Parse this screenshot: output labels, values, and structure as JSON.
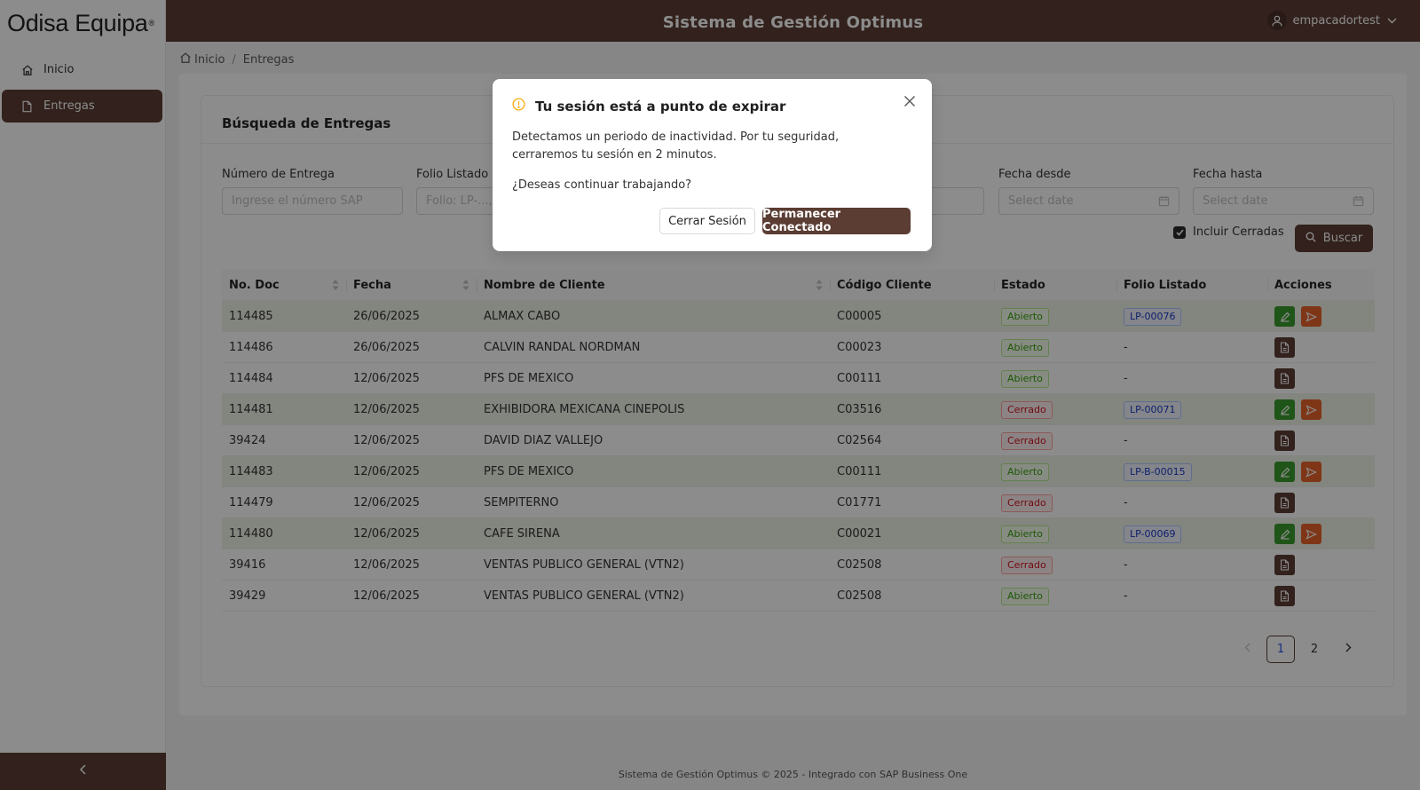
{
  "brand": {
    "name": "Odisa Equipa",
    "mark": "®"
  },
  "header": {
    "title": "Sistema de Gestión Optimus",
    "user": "empacadortest"
  },
  "sidebar": {
    "items": [
      {
        "label": "Inicio"
      },
      {
        "label": "Entregas"
      }
    ]
  },
  "breadcrumb": {
    "home": "Inicio",
    "current": "Entregas"
  },
  "search": {
    "title": "Búsqueda de Entregas",
    "fields": [
      {
        "label": "Número de Entrega",
        "placeholder": "Ingrese el número SAP"
      },
      {
        "label": "Folio Listado",
        "placeholder": "Folio: LP-..., L"
      },
      {
        "label": "Fecha desde",
        "placeholder": "Select date"
      },
      {
        "label": "Fecha hasta",
        "placeholder": "Select date"
      }
    ],
    "include_closed": "Incluir Cerradas",
    "button": "Buscar"
  },
  "table": {
    "headers": [
      "No. Doc",
      "Fecha",
      "Nombre de Cliente",
      "Código Cliente",
      "Estado",
      "Folio Listado",
      "Acciones"
    ],
    "rows": [
      {
        "doc": "114485",
        "fecha": "26/06/2025",
        "cliente": "ALMAX CABO",
        "codigo": "C00005",
        "estado": "Abierto",
        "folio": "LP-00076"
      },
      {
        "doc": "114486",
        "fecha": "26/06/2025",
        "cliente": "CALVIN RANDAL NORDMAN",
        "codigo": "C00023",
        "estado": "Abierto",
        "folio": "-"
      },
      {
        "doc": "114484",
        "fecha": "12/06/2025",
        "cliente": "PFS DE MEXICO",
        "codigo": "C00111",
        "estado": "Abierto",
        "folio": "-"
      },
      {
        "doc": "114481",
        "fecha": "12/06/2025",
        "cliente": "EXHIBIDORA MEXICANA CINEPOLIS",
        "codigo": "C03516",
        "estado": "Cerrado",
        "folio": "LP-00071"
      },
      {
        "doc": "39424",
        "fecha": "12/06/2025",
        "cliente": "DAVID DIAZ VALLEJO",
        "codigo": "C02564",
        "estado": "Cerrado",
        "folio": "-"
      },
      {
        "doc": "114483",
        "fecha": "12/06/2025",
        "cliente": "PFS DE MEXICO",
        "codigo": "C00111",
        "estado": "Abierto",
        "folio": "LP-B-00015"
      },
      {
        "doc": "114479",
        "fecha": "12/06/2025",
        "cliente": "SEMPITERNO",
        "codigo": "C01771",
        "estado": "Cerrado",
        "folio": "-"
      },
      {
        "doc": "114480",
        "fecha": "12/06/2025",
        "cliente": "CAFE SIRENA",
        "codigo": "C00021",
        "estado": "Abierto",
        "folio": "LP-00069"
      },
      {
        "doc": "39416",
        "fecha": "12/06/2025",
        "cliente": "VENTAS PUBLICO GENERAL (VTN2)",
        "codigo": "C02508",
        "estado": "Cerrado",
        "folio": "-"
      },
      {
        "doc": "39429",
        "fecha": "12/06/2025",
        "cliente": "VENTAS PUBLICO GENERAL (VTN2)",
        "codigo": "C02508",
        "estado": "Abierto",
        "folio": "-"
      }
    ]
  },
  "pagination": {
    "pages": [
      "1",
      "2"
    ],
    "current": "1"
  },
  "footer": "Sistema de Gestión Optimus © 2025 - Integrado con SAP Business One",
  "modal": {
    "title": "Tu sesión está a punto de expirar",
    "message": "Detectamos un periodo de inactividad. Por tu seguridad, cerraremos tu sesión en 2 minutos.",
    "question": "¿Deseas continuar trabajando?",
    "cancel": "Cerrar Sesión",
    "confirm": "Permanecer Conectado"
  },
  "colors": {
    "brand": "#5b3d33",
    "edit": "#3a9b2c",
    "send": "#e8632b",
    "warning": "#faad14"
  }
}
